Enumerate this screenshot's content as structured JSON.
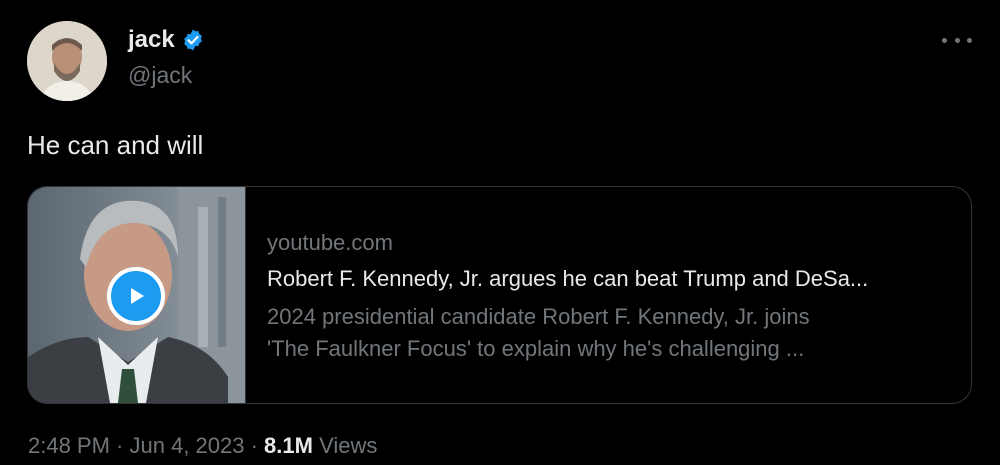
{
  "author": {
    "display_name": "jack",
    "handle": "@jack",
    "verified": true,
    "verified_color": "#1d9bf0"
  },
  "tweet": {
    "text": "He can and will"
  },
  "card": {
    "domain": "youtube.com",
    "title": "Robert F. Kennedy, Jr. argues he can beat Trump and DeSa...",
    "description_line1": "2024 presidential candidate Robert F. Kennedy, Jr. joins",
    "description_line2": "'The Faulkner Focus' to explain why he's challenging ..."
  },
  "meta": {
    "time": "2:48 PM",
    "separator1": " · ",
    "date": "Jun 4, 2023",
    "separator2": " · ",
    "views_count": "8.1M",
    "views_label": " Views"
  },
  "icons": {
    "verified": "verified-badge-icon",
    "more": "more-options-icon",
    "play": "play-icon"
  },
  "colors": {
    "background": "#000000",
    "primary_text": "#e7e9ea",
    "secondary_text": "#71767b",
    "border": "#333639",
    "accent": "#1d9bf0"
  }
}
